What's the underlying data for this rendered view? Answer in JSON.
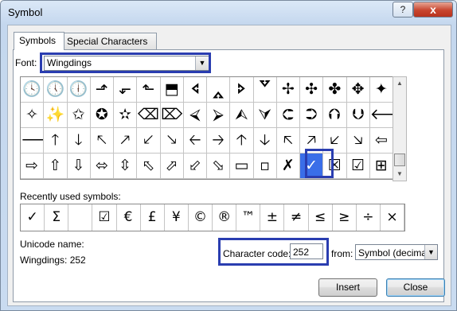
{
  "window": {
    "title": "Symbol",
    "help_label": "?",
    "close_label": "x"
  },
  "tabs": [
    {
      "label": "Symbols",
      "selected": true
    },
    {
      "label": "Special Characters",
      "selected": false
    }
  ],
  "font": {
    "label": "Font:",
    "value": "Wingdings"
  },
  "symbol_grid": {
    "rows": [
      [
        "🕓",
        "🕔",
        "🕕",
        "⬏",
        "⬐",
        "⬑",
        "⬒",
        "🢔",
        "🢕",
        "🢖",
        "🢗",
        "✢",
        "✣",
        "✤",
        "✥",
        "✦"
      ],
      [
        "✧",
        "✨",
        "✩",
        "✪",
        "✫",
        "⌫",
        "⌦",
        "⮘",
        "⮚",
        "⮙",
        "⮛",
        "⮈",
        "⮊",
        "⮉",
        "⮋",
        "🡐"
      ],
      [
        "🡒",
        "🡑",
        "🡓",
        "🡔",
        "🡕",
        "🡗",
        "🡖",
        "🡠",
        "🡢",
        "🡡",
        "🡣",
        "🡤",
        "🡥",
        "🡧",
        "🡦",
        "⇦"
      ],
      [
        "⇨",
        "⇧",
        "⇩",
        "⬄",
        "⇳",
        "⬁",
        "⬀",
        "⬃",
        "⬂",
        "▭",
        "▫",
        "✗",
        "✓",
        "☒",
        "☑",
        "⊞"
      ]
    ],
    "selected": {
      "row": 3,
      "col": 12,
      "glyph": "✓"
    }
  },
  "recent": {
    "label": "Recently used symbols:",
    "symbols": [
      "✓",
      "Σ",
      "",
      "☑",
      "€",
      "£",
      "¥",
      "©",
      "®",
      "™",
      "±",
      "≠",
      "≤",
      "≥",
      "÷",
      "×"
    ]
  },
  "unicode": {
    "label": "Unicode name:",
    "value": "Wingdings: 252"
  },
  "character_code": {
    "label": "Character code:",
    "value": "252"
  },
  "from": {
    "label": "from:",
    "value": "Symbol (decimal)"
  },
  "buttons": {
    "insert": "Insert",
    "close": "Close"
  },
  "colors": {
    "highlight": "#2a3db0",
    "selection": "#3a6ee8"
  }
}
